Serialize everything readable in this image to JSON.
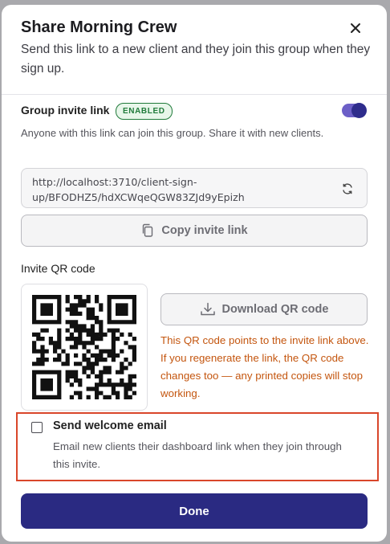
{
  "dialog": {
    "title": "Share Morning Crew",
    "subtitle": "Send this link to a new client and they join this group when they sign up."
  },
  "invite": {
    "label": "Group invite link",
    "badge": "ENABLED",
    "toggle_on": true,
    "description": "Anyone with this link can join this group. Share it with new clients.",
    "url": "http://localhost:3710/client-sign-up/BFODHZ5/hdXCWqeQGW83ZJd9yEpizh",
    "copy_label": "Copy invite link"
  },
  "qr": {
    "label": "Invite QR code",
    "download_label": "Download QR code",
    "note": "This QR code points to the invite link above. If you regenerate the link, the QR code changes too — any printed copies will stop working."
  },
  "welcome": {
    "checked": false,
    "title": "Send welcome email",
    "description": "Email new clients their dashboard link when they join through this invite."
  },
  "footer": {
    "done_label": "Done"
  },
  "colors": {
    "primary": "#2a2a82",
    "toggle": "#6c5fc7",
    "badge_green": "#1f7a3a",
    "warning_text": "#c4560f",
    "highlight_border": "#d9462a"
  },
  "icons": [
    "close-icon",
    "refresh-icon",
    "copy-icon",
    "download-icon",
    "qr-code-image",
    "checkbox"
  ]
}
